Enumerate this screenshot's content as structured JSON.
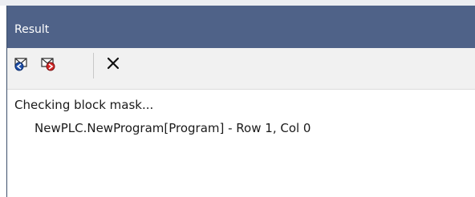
{
  "panel": {
    "title": "Result"
  },
  "toolbar": {
    "buttons": [
      {
        "icon": "previous-message-icon"
      },
      {
        "icon": "next-message-icon"
      },
      {
        "icon": "clear-icon"
      }
    ]
  },
  "results": {
    "lines": [
      "Checking block mask...",
      "NewPLC.NewProgram[Program] - Row 1, Col 0"
    ]
  },
  "colors": {
    "title_bar": "#4f6288",
    "toolbar": "#f1f1f1",
    "content": "#ffffff"
  }
}
